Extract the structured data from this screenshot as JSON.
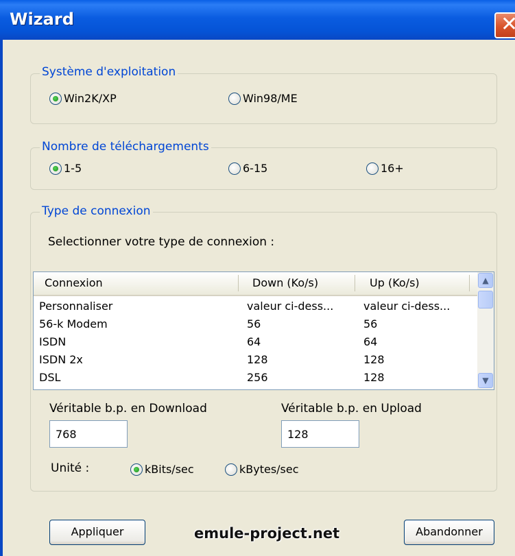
{
  "window": {
    "title": "Wizard",
    "close_label": "✕"
  },
  "os_group": {
    "legend": "Système d'exploitation",
    "options": [
      {
        "label": "Win2K/XP",
        "selected": true
      },
      {
        "label": "Win98/ME",
        "selected": false
      }
    ]
  },
  "downloads_group": {
    "legend": "Nombre de téléchargements",
    "options": [
      {
        "label": "1-5",
        "selected": true
      },
      {
        "label": "6-15",
        "selected": false
      },
      {
        "label": "16+",
        "selected": false
      }
    ]
  },
  "connection_group": {
    "legend": "Type de connexion",
    "instruction": "Selectionner votre type de connexion :",
    "columns": [
      "Connexion",
      "Down (Ko/s)",
      "Up (Ko/s)"
    ],
    "rows": [
      [
        "Personnaliser",
        "valeur ci-dess...",
        "valeur ci-dess..."
      ],
      [
        "56-k Modem",
        "56",
        "56"
      ],
      [
        "ISDN",
        "64",
        "64"
      ],
      [
        "ISDN 2x",
        "128",
        "128"
      ],
      [
        "DSL",
        "256",
        "128"
      ]
    ],
    "download_label": "Véritable b.p. en Download",
    "download_value": "768",
    "upload_label": "Véritable b.p. en Upload",
    "upload_value": "128",
    "unit_label": "Unité :",
    "units": [
      {
        "label": "kBits/sec",
        "selected": true
      },
      {
        "label": "kBytes/sec",
        "selected": false
      }
    ]
  },
  "buttons": {
    "apply": "Appliquer",
    "cancel": "Abandonner"
  },
  "watermark": "emule-project.net",
  "colors": {
    "titlebar": "#0553d6",
    "legend_text": "#0046d5",
    "window_bg": "#ece9d8",
    "close_button": "#d9542b"
  }
}
